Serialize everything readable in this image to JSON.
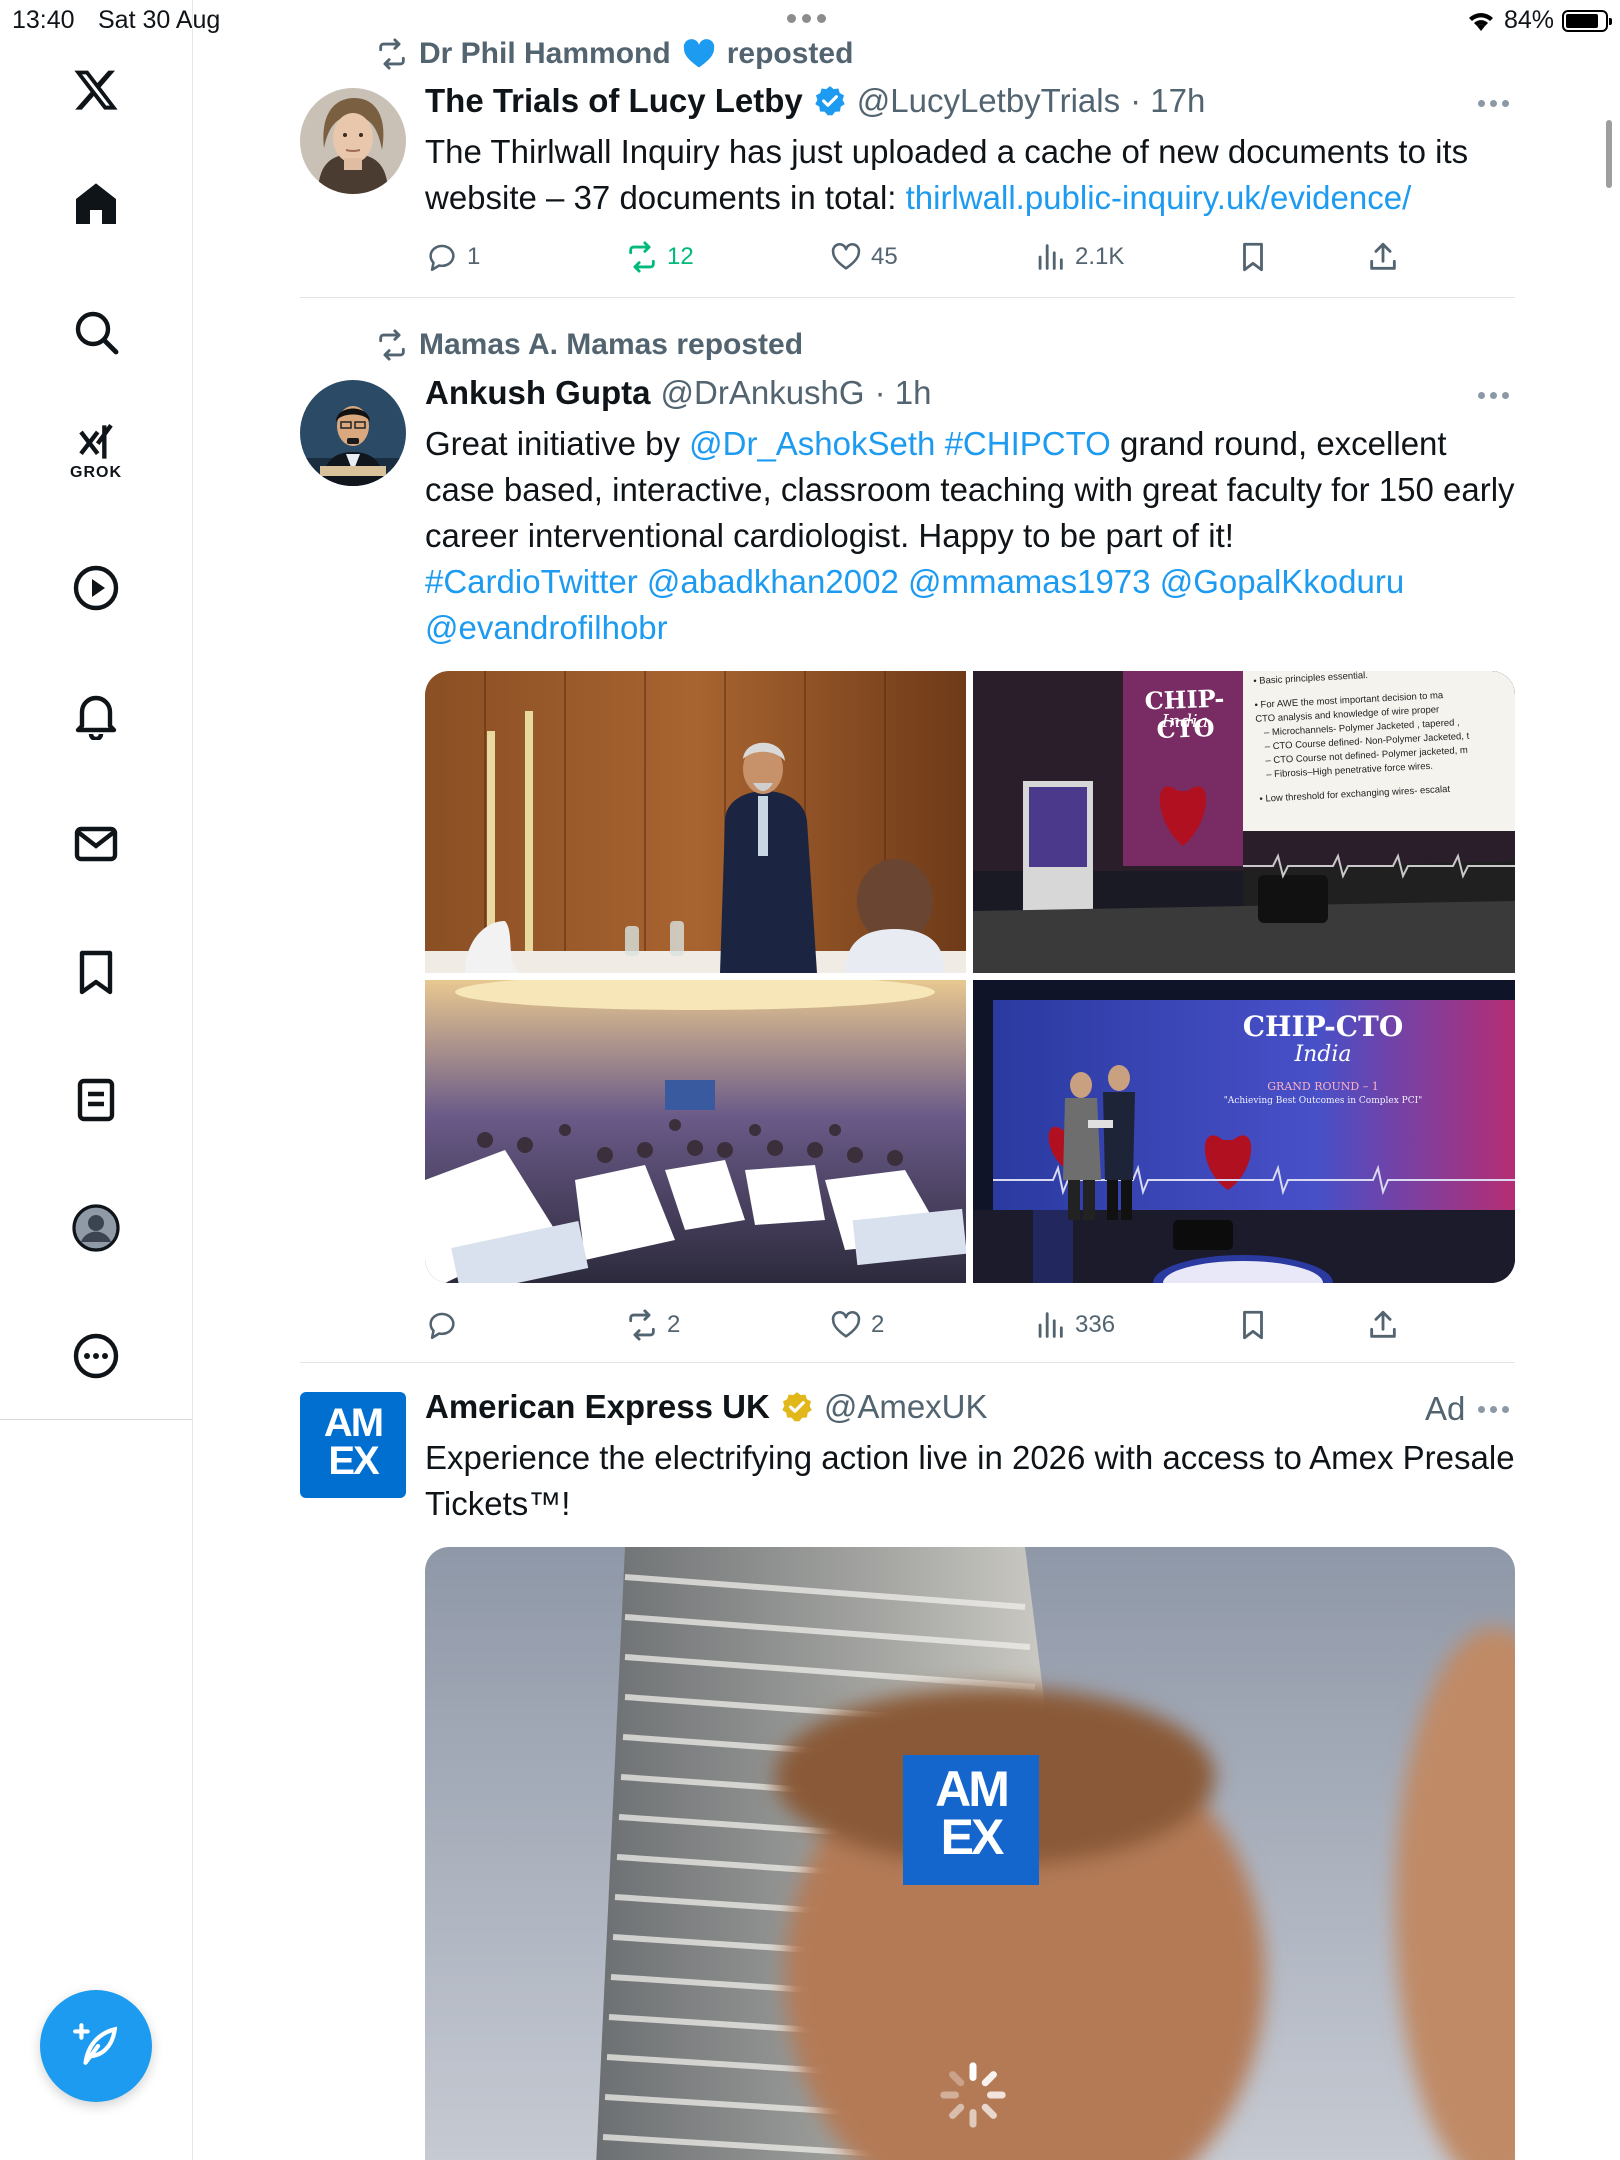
{
  "status_bar": {
    "time": "13:40",
    "date": "Sat 30 Aug",
    "battery": "84%"
  },
  "sidebar": {
    "items": [
      {
        "name": "x-logo"
      },
      {
        "name": "home"
      },
      {
        "name": "search"
      },
      {
        "name": "grok",
        "label": "GROK"
      },
      {
        "name": "video"
      },
      {
        "name": "notifications"
      },
      {
        "name": "messages"
      },
      {
        "name": "bookmarks"
      },
      {
        "name": "lists"
      },
      {
        "name": "profile"
      },
      {
        "name": "more"
      }
    ],
    "compose_icon": "feather-plus-icon"
  },
  "feed": {
    "tweets": [
      {
        "repost_by": "Dr Phil Hammond",
        "repost_suffix": "reposted",
        "display_name": "The Trials of Lucy Letby",
        "handle": "@LucyLetbyTrials",
        "time": "· 17h",
        "text": "The Thirlwall Inquiry has just uploaded a cache of new documents to its website – 37 documents in total: ",
        "link": "thirlwall.public-inquiry.uk/evidence/",
        "replies": "1",
        "reposts": "12",
        "likes": "45",
        "views": "2.1K"
      },
      {
        "repost_by": "Mamas A. Mamas reposted",
        "display_name": "Ankush Gupta",
        "handle": "@DrAnkushG",
        "time": "· 1h",
        "text_before": "Great initiative by ",
        "mention_1": "@Dr_AshokSeth",
        "mention_2": "#CHIPCTO",
        "text_after": " grand round, excellent case based, interactive, classroom teaching with great faculty for 150 early career interventional cardiologist. Happy to be part of it!",
        "tags": "#CardioTwitter @abadkhan2002 @mmamas1973 @GopalKkoduru @evandrofilhobr",
        "replies": "",
        "reposts": "2",
        "likes": "2",
        "views": "336",
        "images": {
          "slide_title": "CHIP-CTO",
          "slide_subtitle": "India",
          "slide_grand": "GRAND ROUND – 1",
          "slide_tagline": "\"Achieving Best Outcomes in Complex PCI\"",
          "slide_bullets": [
            "• Basic principles essential.",
            "• For AWE the most important decision to ma",
            "CTO analysis and knowledge of wire proper",
            "– Microchannels- Polymer Jacketed , tapered ,",
            "– CTO Course defined- Non-Polymer Jacketed, t",
            "– CTO Course not defined- Polymer jacketed, m",
            "– Fibrosis–High penetrative force wires.",
            "• Low threshold for exchanging wires- escalat"
          ]
        }
      },
      {
        "display_name": "American Express UK",
        "handle": "@AmexUK",
        "ad_label": "Ad",
        "text": "Experience the electrifying action live in 2026 with access to Amex Presale Tickets™!",
        "logo_text_1": "AM",
        "logo_text_2": "EX"
      }
    ]
  },
  "colors": {
    "accent": "#1d9bf0",
    "repost_green": "#00ba7c",
    "muted_text": "#536471",
    "verified_gold": "#e2b719",
    "amex_blue": "#016fd0"
  }
}
